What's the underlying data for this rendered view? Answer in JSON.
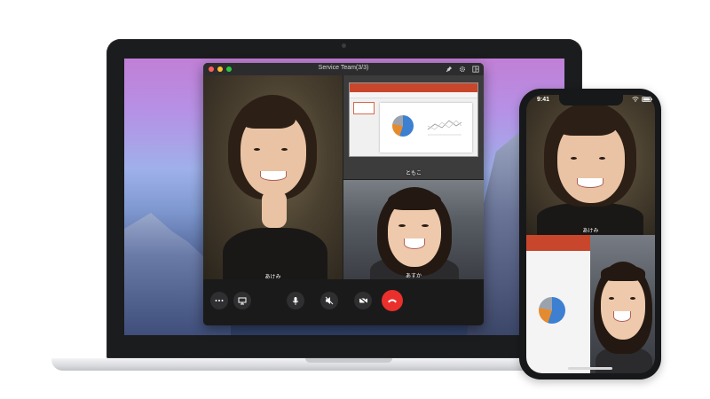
{
  "window": {
    "title": "Service Team(3/3)"
  },
  "participants": [
    {
      "name": "あけみ"
    },
    {
      "name": "ともこ"
    },
    {
      "name": "あすか"
    }
  ],
  "phone": {
    "time": "9:41",
    "participant_top_name": "あけみ"
  },
  "icons": {
    "pin": "pin-icon",
    "settings": "gear-icon",
    "layout": "layout-icon",
    "more": "more-icon",
    "screen_share": "screen-share-icon",
    "mic": "microphone-icon",
    "speaker_mute": "speaker-mute-icon",
    "video_off": "video-off-icon",
    "end_call": "end-call-icon"
  },
  "colors": {
    "end_call": "#e9302d",
    "control_button": "#2f2f31",
    "slide_ribbon": "#c8472c",
    "traffic_red": "#ff5f57",
    "traffic_yellow": "#febc2e",
    "traffic_green": "#28c840"
  }
}
